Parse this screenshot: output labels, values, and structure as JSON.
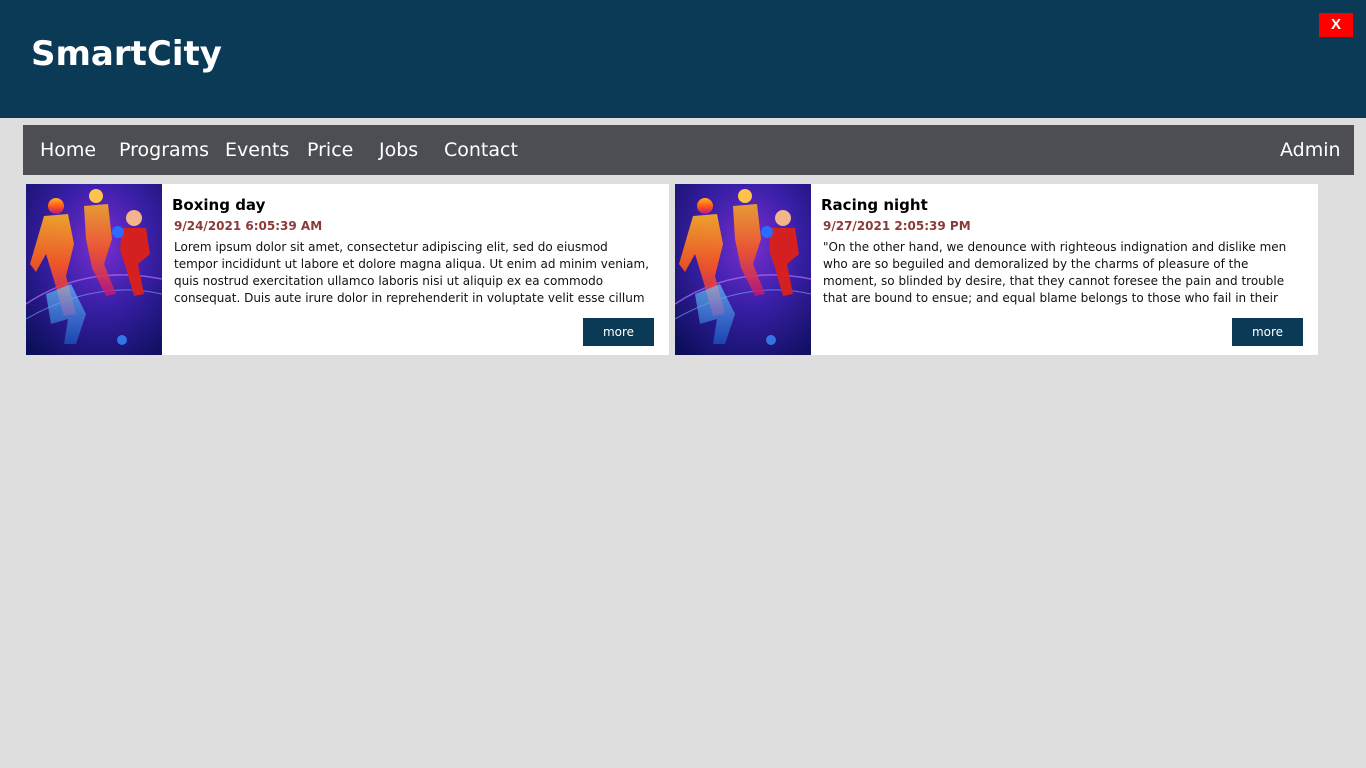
{
  "header": {
    "title": "SmartCity",
    "close_label": "X",
    "background": "#0a3a55",
    "close_color": "#ff0000"
  },
  "nav": {
    "items": [
      {
        "label": "Home"
      },
      {
        "label": "Programs"
      },
      {
        "label": "Events"
      },
      {
        "label": "Price"
      },
      {
        "label": "Jobs"
      },
      {
        "label": "Contact"
      }
    ],
    "admin_label": "Admin",
    "background": "#4d4e53"
  },
  "cards": [
    {
      "title": "Boxing day",
      "date": "9/24/2021 6:05:39 AM",
      "text": "Lorem ipsum dolor sit amet, consectetur adipiscing elit, sed do eiusmod tempor incididunt ut labore et dolore magna aliqua. Ut enim ad minim veniam, quis nostrud exercitation ullamco laboris nisi ut aliquip ex ea commodo consequat. Duis aute irure dolor in reprehenderit in voluptate velit esse cillum dolore eu",
      "more_label": "more",
      "image": "sports-collage"
    },
    {
      "title": "Racing night",
      "date": "9/27/2021 2:05:39 PM",
      "text": "\"On the other hand, we denounce with righteous indignation and dislike men who are so beguiled and demoralized by the charms of pleasure of the moment, so blinded by desire, that they cannot foresee the pain and trouble that are bound to ensue; and equal blame belongs to those who fail in their duty through",
      "more_label": "more",
      "image": "sports-collage"
    }
  ],
  "colors": {
    "page_background": "#dedede",
    "date_color": "#8b3a3a",
    "button_color": "#0a3a55"
  }
}
